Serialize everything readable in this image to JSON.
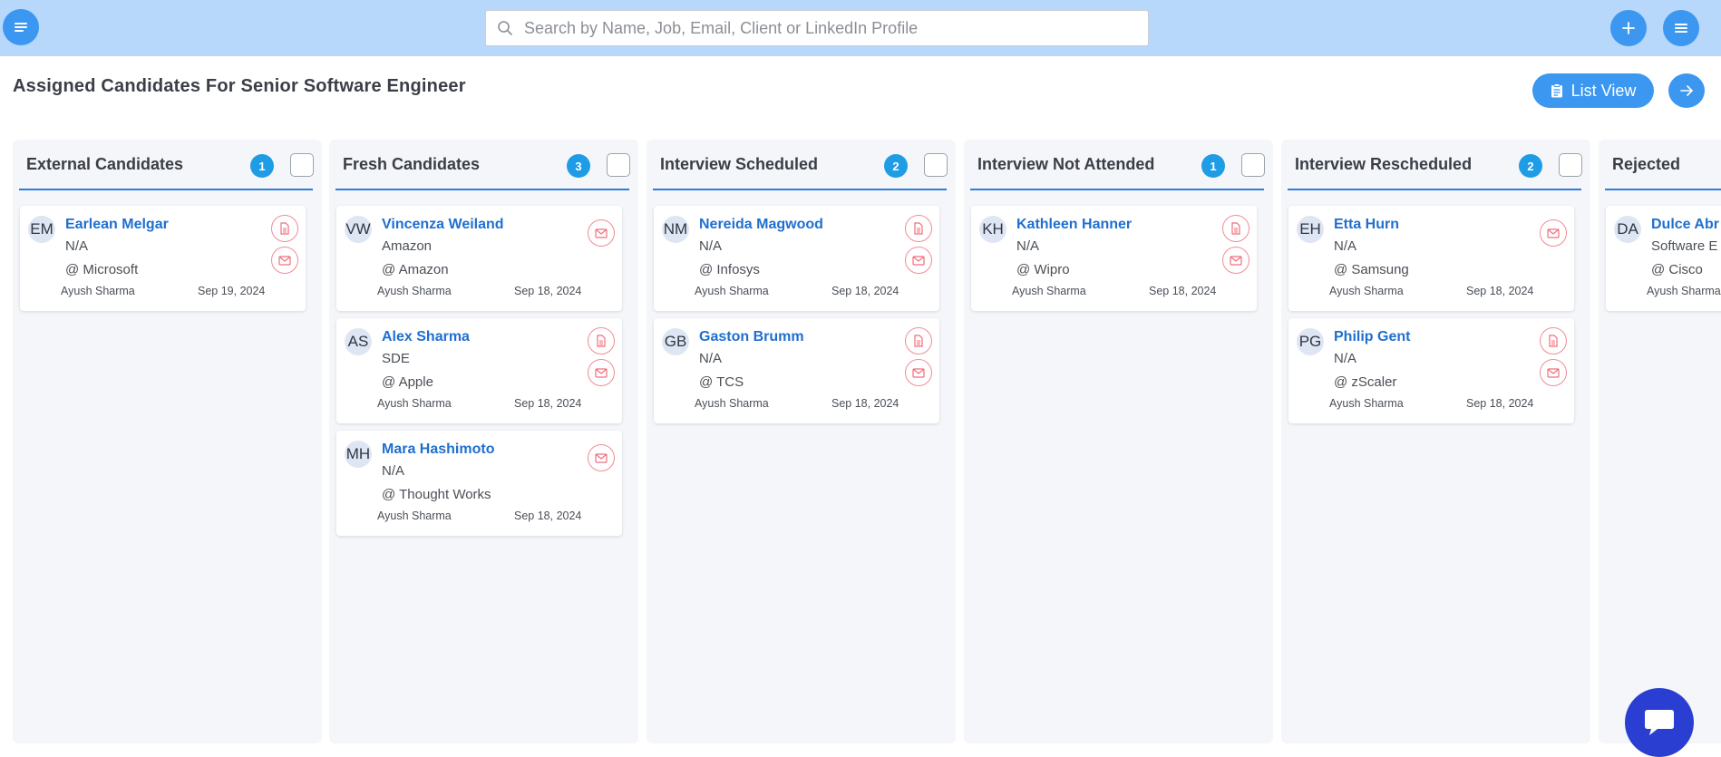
{
  "header": {
    "search_placeholder": "Search by Name, Job, Email, Client or LinkedIn Profile"
  },
  "page": {
    "title": "Assigned Candidates For Senior Software Engineer",
    "list_view_label": "List View"
  },
  "colors": {
    "topbar": "#b7d7fb",
    "accent": "#3b97f0",
    "count_badge": "#1e9ce6",
    "candidate_name": "#1f6fcf",
    "icon_outline": "#f28b96",
    "chat": "#2a3fd1"
  },
  "columns": [
    {
      "title": "External Candidates",
      "count": "1",
      "cards": [
        {
          "initials": "EM",
          "name": "Earlean Melgar",
          "role": "N/A",
          "company": "@ Microsoft",
          "recruiter": "Ayush Sharma",
          "date": "Sep 19, 2024",
          "icons": [
            "document-icon",
            "mail-icon"
          ]
        }
      ]
    },
    {
      "title": "Fresh Candidates",
      "count": "3",
      "cards": [
        {
          "initials": "VW",
          "name": "Vincenza Weiland",
          "role": "Amazon",
          "company": "@ Amazon",
          "recruiter": "Ayush Sharma",
          "date": "Sep 18, 2024",
          "icons": [
            "mail-icon"
          ]
        },
        {
          "initials": "AS",
          "name": "Alex Sharma",
          "role": "SDE",
          "company": "@ Apple",
          "recruiter": "Ayush Sharma",
          "date": "Sep 18, 2024",
          "icons": [
            "document-icon",
            "mail-icon"
          ]
        },
        {
          "initials": "MH",
          "name": "Mara Hashimoto",
          "role": "N/A",
          "company": "@ Thought Works",
          "recruiter": "Ayush Sharma",
          "date": "Sep 18, 2024",
          "icons": [
            "mail-icon"
          ]
        }
      ]
    },
    {
      "title": "Interview Scheduled",
      "count": "2",
      "cards": [
        {
          "initials": "NM",
          "name": "Nereida Magwood",
          "role": "N/A",
          "company": "@ Infosys",
          "recruiter": "Ayush Sharma",
          "date": "Sep 18, 2024",
          "icons": [
            "document-icon",
            "mail-icon"
          ]
        },
        {
          "initials": "GB",
          "name": "Gaston Brumm",
          "role": "N/A",
          "company": "@ TCS",
          "recruiter": "Ayush Sharma",
          "date": "Sep 18, 2024",
          "icons": [
            "document-icon",
            "mail-icon"
          ]
        }
      ]
    },
    {
      "title": "Interview Not Attended",
      "count": "1",
      "cards": [
        {
          "initials": "KH",
          "name": "Kathleen Hanner",
          "role": "N/A",
          "company": "@ Wipro",
          "recruiter": "Ayush Sharma",
          "date": "Sep 18, 2024",
          "icons": [
            "document-icon",
            "mail-icon"
          ]
        }
      ]
    },
    {
      "title": "Interview Rescheduled",
      "count": "2",
      "cards": [
        {
          "initials": "EH",
          "name": "Etta Hurn",
          "role": "N/A",
          "company": "@ Samsung",
          "recruiter": "Ayush Sharma",
          "date": "Sep 18, 2024",
          "icons": [
            "mail-icon"
          ]
        },
        {
          "initials": "PG",
          "name": "Philip Gent",
          "role": "N/A",
          "company": "@ zScaler",
          "recruiter": "Ayush Sharma",
          "date": "Sep 18, 2024",
          "icons": [
            "document-icon",
            "mail-icon"
          ]
        }
      ]
    },
    {
      "title": "Rejected",
      "count": "",
      "cards": [
        {
          "initials": "DA",
          "name": "Dulce Abr",
          "role": "Software E",
          "company": "@ Cisco",
          "recruiter": "Ayush Sharma",
          "date": "",
          "icons": []
        }
      ]
    }
  ]
}
